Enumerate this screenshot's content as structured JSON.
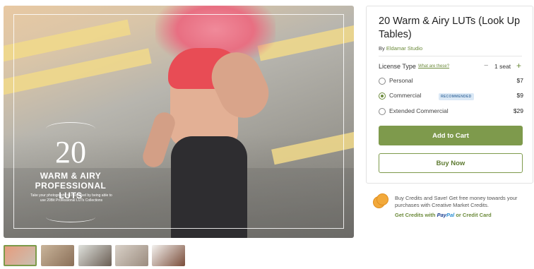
{
  "product": {
    "title": "20 Warm & Airy LUTs (Look Up Tables)",
    "by_prefix": "By",
    "author": "Eldamar Studio"
  },
  "hero": {
    "overlay_number": "20",
    "overlay_line1": "WARM & AIRY",
    "overlay_line2": "PROFESSIONAL LUTS",
    "overlay_sub": "Take your photography to next level by being able to use 20Bit Professional LUTs Collections"
  },
  "license": {
    "label": "License Type",
    "help_link": "What are these?",
    "seat_minus": "−",
    "seat_count": "1 seat",
    "seat_plus": "+",
    "options": [
      {
        "label": "Personal",
        "price": "$7",
        "selected": false
      },
      {
        "label": "Commercial",
        "price": "$9",
        "selected": true,
        "badge": "RECOMMENDED"
      },
      {
        "label": "Extended Commercial",
        "price": "$29",
        "selected": false
      }
    ]
  },
  "actions": {
    "add_to_cart": "Add to Cart",
    "buy_now": "Buy Now"
  },
  "credits": {
    "text": "Buy Credits and Save! Get free money towards your purchases with Creative Market Credits.",
    "link_prefix": "Get Credits with",
    "paypal_1": "Pay",
    "paypal_2": "Pal",
    "link_suffix": "or Credit Card"
  },
  "thumbnails": [
    {
      "name": "thumb-1",
      "active": true,
      "colors": [
        "#e89a7a",
        "#c8c2b6"
      ]
    },
    {
      "name": "thumb-2",
      "active": false,
      "colors": [
        "#c9b49a",
        "#8a6f58"
      ]
    },
    {
      "name": "thumb-3",
      "active": false,
      "colors": [
        "#dfe1dc",
        "#6a5e54"
      ]
    },
    {
      "name": "thumb-4",
      "active": false,
      "colors": [
        "#d9d1c8",
        "#9b8c7f"
      ]
    },
    {
      "name": "thumb-5",
      "active": false,
      "colors": [
        "#f4f2ef",
        "#7a4d3a"
      ]
    }
  ],
  "colors": {
    "accent": "#7e9a4c",
    "badge_bg": "#dbe9f6",
    "badge_text": "#4d7aa8"
  }
}
